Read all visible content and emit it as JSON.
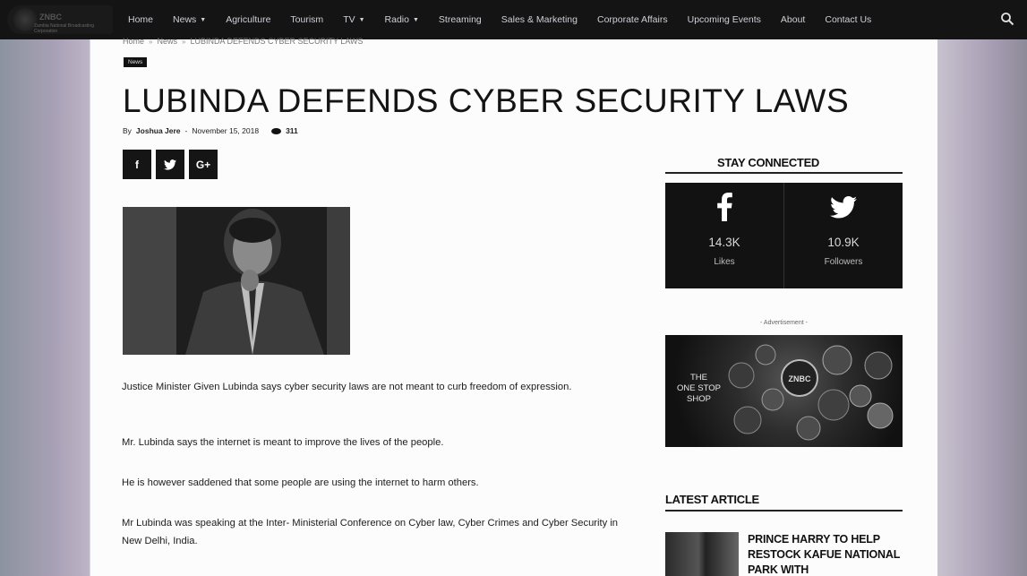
{
  "site": {
    "logo_text": "ZNBC",
    "logo_tagline": "Zambia National Broadcasting Corporation"
  },
  "nav": {
    "items": [
      {
        "label": "Home",
        "dropdown": false
      },
      {
        "label": "News",
        "dropdown": true
      },
      {
        "label": "Agriculture",
        "dropdown": false
      },
      {
        "label": "Tourism",
        "dropdown": false
      },
      {
        "label": "TV",
        "dropdown": true
      },
      {
        "label": "Radio",
        "dropdown": true
      },
      {
        "label": "Streaming",
        "dropdown": false
      },
      {
        "label": "Sales & Marketing",
        "dropdown": false
      },
      {
        "label": "Corporate Affairs",
        "dropdown": false
      },
      {
        "label": "Upcoming Events",
        "dropdown": false
      },
      {
        "label": "About",
        "dropdown": false
      },
      {
        "label": "Contact Us",
        "dropdown": false
      }
    ],
    "search_icon": "search-icon"
  },
  "breadcrumb": {
    "items": [
      "Home",
      "News",
      "LUBINDA DEFENDS CYBER SECURITY LAWS"
    ],
    "separator": "»"
  },
  "article": {
    "category": "News",
    "title": "LUBINDA DEFENDS CYBER SECURITY LAWS",
    "by_label": "By",
    "author": "Joshua Jere",
    "dash": "-",
    "date": "November 15, 2018",
    "views": "311",
    "share": {
      "facebook": "f",
      "twitter": "twitter-icon",
      "googleplus": "G+"
    },
    "paragraphs": [
      "Justice Minister Given Lubinda says cyber security laws are not meant to curb freedom of expression.",
      "Mr. Lubinda says the internet is meant to improve the lives of the people.",
      "He is however saddened that some people are using the internet to harm others.",
      "Mr Lubinda was speaking at the Inter- Ministerial Conference on Cyber law, Cyber Crimes and Cyber Security in New Delhi, India."
    ]
  },
  "sidebar": {
    "stay_connected": "STAY CONNECTED",
    "social": [
      {
        "icon": "facebook-icon",
        "count": "14.3K",
        "unit": "Likes"
      },
      {
        "icon": "twitter-icon",
        "count": "10.9K",
        "unit": "Followers"
      }
    ],
    "ad_label": "- Advertisement -",
    "ad_text_lines": [
      "THE",
      "ONE STOP",
      "SHOP"
    ],
    "ad_brand": "ZNBC",
    "latest_heading": "LATEST ARTICLE",
    "latest_title": "PRINCE HARRY TO HELP RESTOCK KAFUE NATIONAL PARK WITH"
  }
}
